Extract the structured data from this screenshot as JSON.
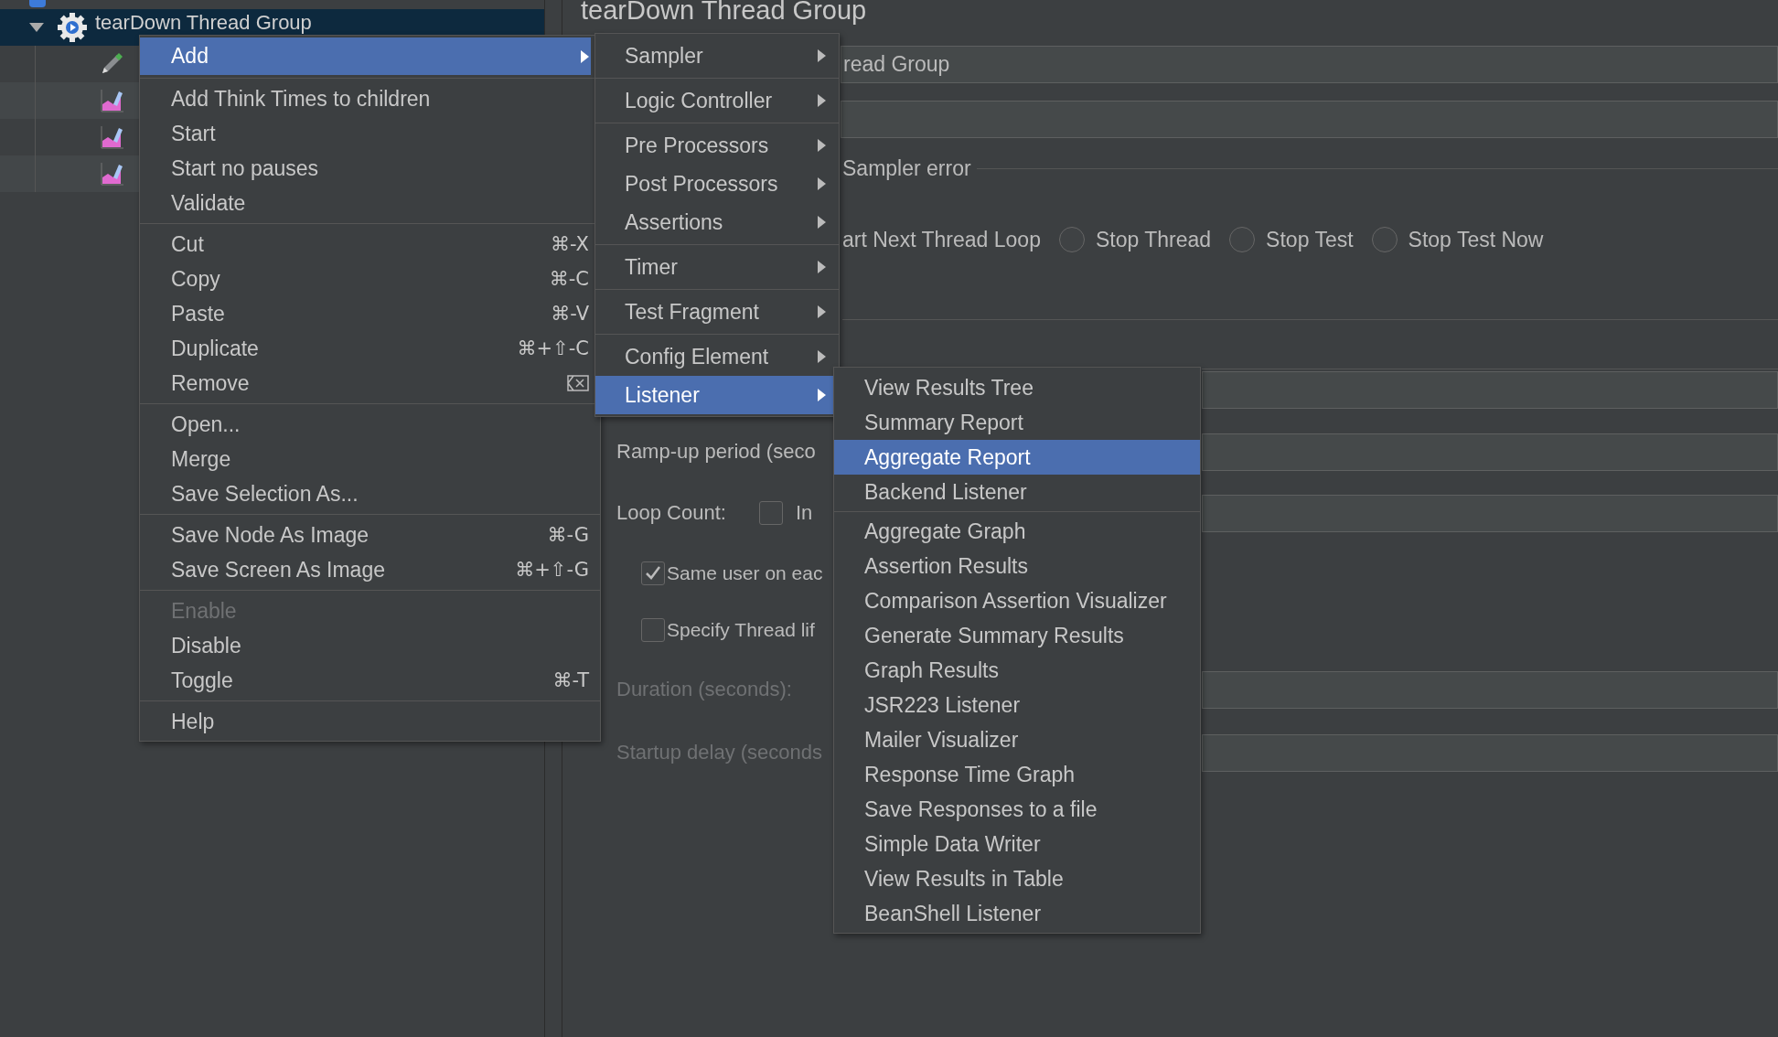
{
  "tree": {
    "node": {
      "label": "tearDown Thread Group",
      "expanded": true,
      "selected": true
    },
    "children": [
      {
        "kind": "pencil"
      },
      {
        "kind": "chart"
      },
      {
        "kind": "chart"
      },
      {
        "kind": "chart"
      }
    ]
  },
  "panel": {
    "title": "tearDown Thread Group",
    "name_value": "read Group",
    "error_legend": "Sampler error",
    "error_first_label": "art Next Thread Loop",
    "error_actions": [
      {
        "label": "Stop Thread",
        "selected": false
      },
      {
        "label": "Stop Test",
        "selected": false
      },
      {
        "label": "Stop Test Now",
        "selected": false
      }
    ],
    "ramp_up_label": "Ramp-up period (seco",
    "loop_count_label": "Loop Count:",
    "infinite": {
      "label": "In",
      "checked": false
    },
    "options": [
      {
        "label": "Same user on eac",
        "checked": true
      },
      {
        "label": "Specify Thread lif",
        "checked": false
      }
    ],
    "timing": [
      {
        "label": "Duration (seconds):",
        "disabled": true
      },
      {
        "label": "Startup delay (seconds",
        "disabled": true
      }
    ]
  },
  "context_menu": {
    "groups": [
      [
        {
          "label": "Add",
          "submenu": true,
          "selected": true,
          "disabled": false
        }
      ],
      [
        {
          "label": "Add Think Times to children",
          "submenu": false,
          "selected": false,
          "disabled": false
        },
        {
          "label": "Start",
          "submenu": false,
          "selected": false,
          "disabled": false
        },
        {
          "label": "Start no pauses",
          "submenu": false,
          "selected": false,
          "disabled": false
        },
        {
          "label": "Validate",
          "submenu": false,
          "selected": false,
          "disabled": false
        }
      ],
      [
        {
          "label": "Cut",
          "shortcut": "⌘-X",
          "submenu": false,
          "selected": false,
          "disabled": false
        },
        {
          "label": "Copy",
          "shortcut": "⌘-C",
          "submenu": false,
          "selected": false,
          "disabled": false
        },
        {
          "label": "Paste",
          "shortcut": "⌘-V",
          "submenu": false,
          "selected": false,
          "disabled": false
        },
        {
          "label": "Duplicate",
          "shortcut": "⌘+⇧-C",
          "submenu": false,
          "selected": false,
          "disabled": false
        },
        {
          "label": "Remove",
          "shortcut_icon": true,
          "submenu": false,
          "selected": false,
          "disabled": false
        }
      ],
      [
        {
          "label": "Open...",
          "submenu": false,
          "selected": false,
          "disabled": false
        },
        {
          "label": "Merge",
          "submenu": false,
          "selected": false,
          "disabled": false
        },
        {
          "label": "Save Selection As...",
          "submenu": false,
          "selected": false,
          "disabled": false
        }
      ],
      [
        {
          "label": "Save Node As Image",
          "shortcut": "⌘-G",
          "submenu": false,
          "selected": false,
          "disabled": false
        },
        {
          "label": "Save Screen As Image",
          "shortcut": "⌘+⇧-G",
          "submenu": false,
          "selected": false,
          "disabled": false
        }
      ],
      [
        {
          "label": "Enable",
          "submenu": false,
          "selected": false,
          "disabled": true
        },
        {
          "label": "Disable",
          "submenu": false,
          "selected": false,
          "disabled": false
        },
        {
          "label": "Toggle",
          "shortcut": "⌘-T",
          "submenu": false,
          "selected": false,
          "disabled": false
        }
      ],
      [
        {
          "label": "Help",
          "submenu": false,
          "selected": false,
          "disabled": false
        }
      ]
    ]
  },
  "add_submenu": {
    "groups": [
      [
        {
          "label": "Sampler",
          "submenu": true,
          "selected": false
        }
      ],
      [
        {
          "label": "Logic Controller",
          "submenu": true,
          "selected": false
        }
      ],
      [
        {
          "label": "Pre Processors",
          "submenu": true,
          "selected": false
        },
        {
          "label": "Post Processors",
          "submenu": true,
          "selected": false
        },
        {
          "label": "Assertions",
          "submenu": true,
          "selected": false
        }
      ],
      [
        {
          "label": "Timer",
          "submenu": true,
          "selected": false
        }
      ],
      [
        {
          "label": "Test Fragment",
          "submenu": true,
          "selected": false
        }
      ],
      [
        {
          "label": "Config Element",
          "submenu": true,
          "selected": false
        },
        {
          "label": "Listener",
          "submenu": true,
          "selected": true
        }
      ]
    ]
  },
  "listener_submenu": {
    "groups": [
      [
        {
          "label": "View Results Tree",
          "selected": false
        },
        {
          "label": "Summary Report",
          "selected": false
        },
        {
          "label": "Aggregate Report",
          "selected": true
        },
        {
          "label": "Backend Listener",
          "selected": false
        }
      ],
      [
        {
          "label": "Aggregate Graph",
          "selected": false
        },
        {
          "label": "Assertion Results",
          "selected": false
        },
        {
          "label": "Comparison Assertion Visualizer",
          "selected": false
        },
        {
          "label": "Generate Summary Results",
          "selected": false
        },
        {
          "label": "Graph Results",
          "selected": false
        },
        {
          "label": "JSR223 Listener",
          "selected": false
        },
        {
          "label": "Mailer Visualizer",
          "selected": false
        },
        {
          "label": "Response Time Graph",
          "selected": false
        },
        {
          "label": "Save Responses to a file",
          "selected": false
        },
        {
          "label": "Simple Data Writer",
          "selected": false
        },
        {
          "label": "View Results in Table",
          "selected": false
        },
        {
          "label": "BeanShell Listener",
          "selected": false
        }
      ]
    ]
  }
}
